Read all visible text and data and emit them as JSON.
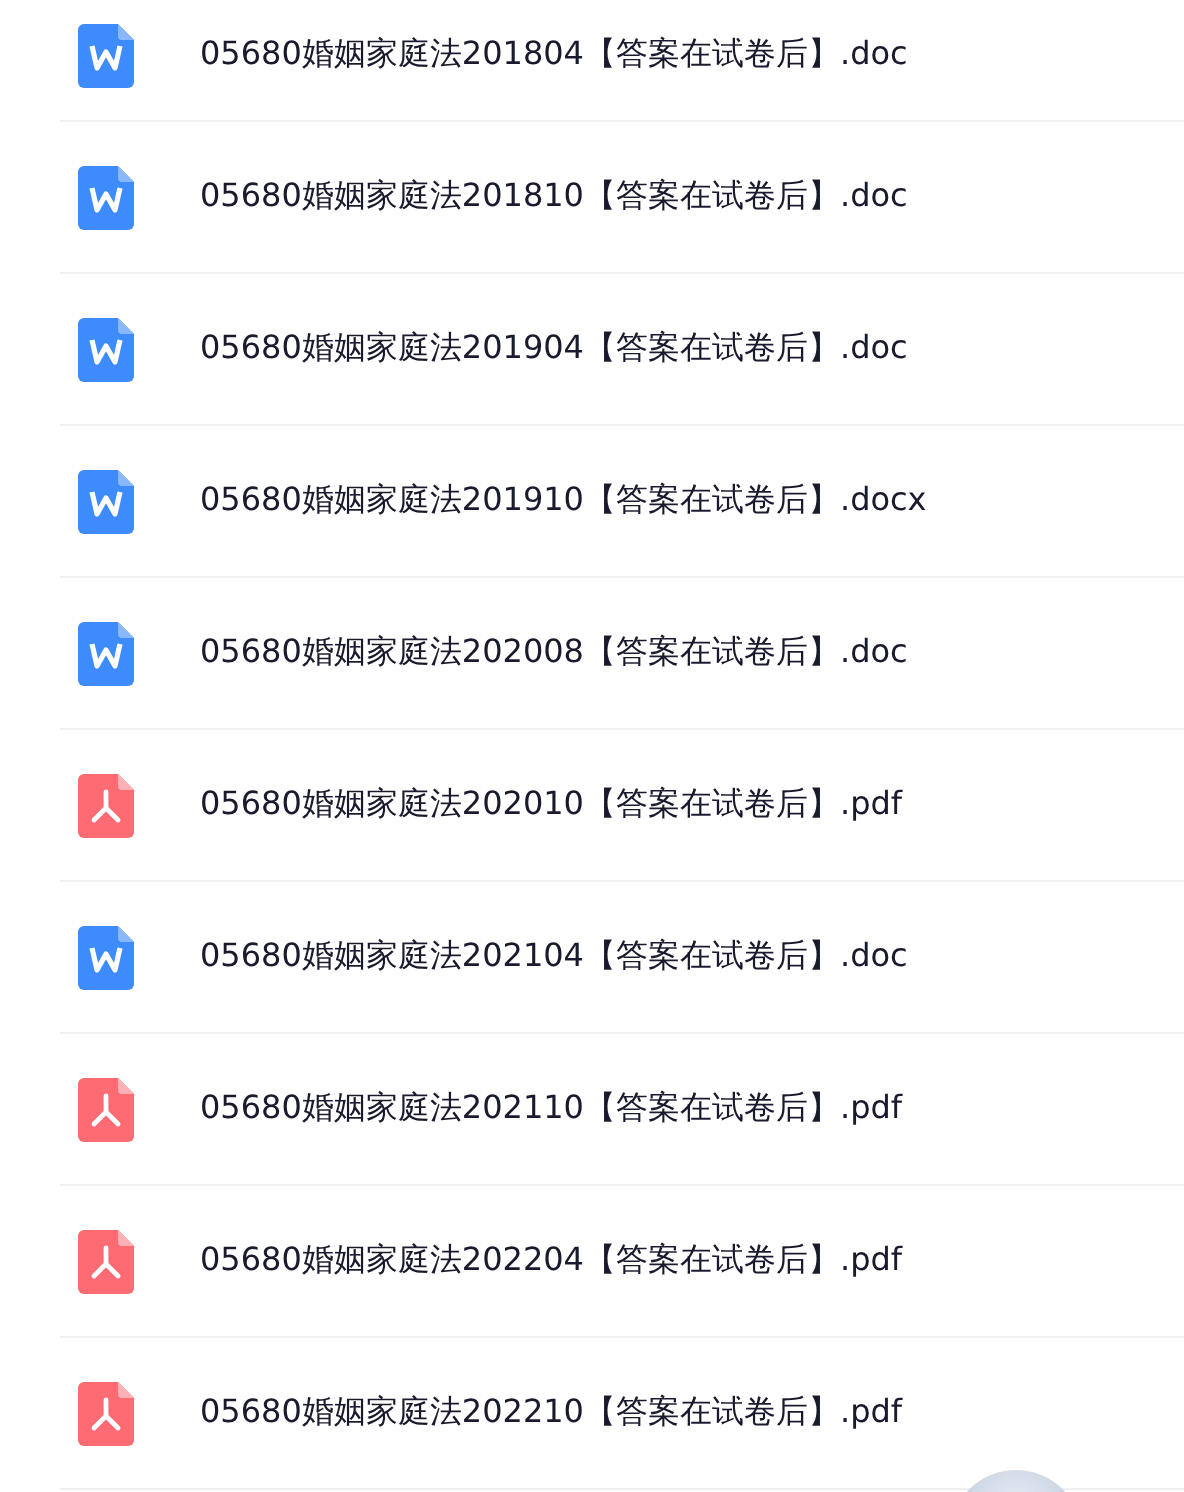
{
  "files": [
    {
      "kind": "word",
      "name": "05680婚姻家庭法201804【答案在试卷后】.doc"
    },
    {
      "kind": "word",
      "name": "05680婚姻家庭法201810【答案在试卷后】.doc"
    },
    {
      "kind": "word",
      "name": "05680婚姻家庭法201904【答案在试卷后】.doc"
    },
    {
      "kind": "word",
      "name": "05680婚姻家庭法201910【答案在试卷后】.docx"
    },
    {
      "kind": "word",
      "name": "05680婚姻家庭法202008【答案在试卷后】.doc"
    },
    {
      "kind": "pdf",
      "name": "05680婚姻家庭法202010【答案在试卷后】.pdf"
    },
    {
      "kind": "word",
      "name": "05680婚姻家庭法202104【答案在试卷后】.doc"
    },
    {
      "kind": "pdf",
      "name": "05680婚姻家庭法202110【答案在试卷后】.pdf"
    },
    {
      "kind": "pdf",
      "name": "05680婚姻家庭法202204【答案在试卷后】.pdf"
    },
    {
      "kind": "pdf",
      "name": "05680婚姻家庭法202210【答案在试卷后】.pdf"
    }
  ]
}
